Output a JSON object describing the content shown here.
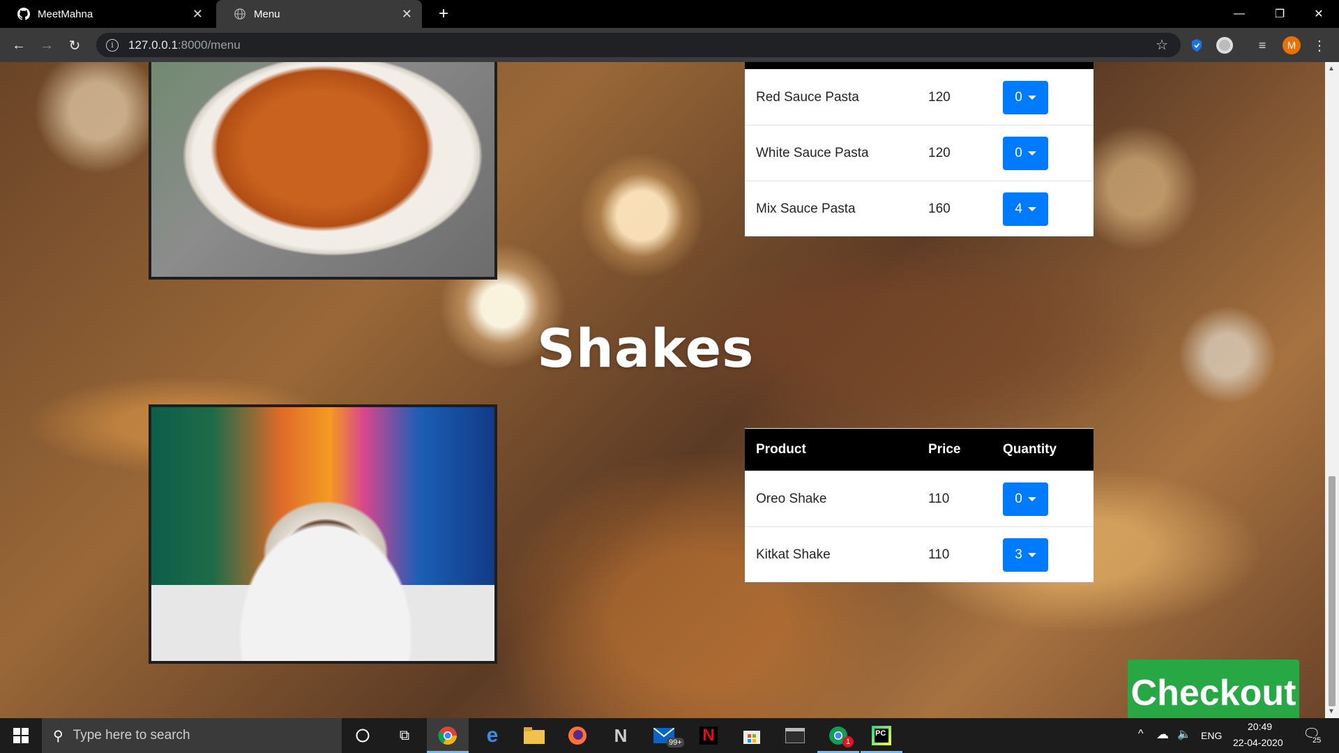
{
  "browser": {
    "tabs": [
      {
        "title": "MeetMahna",
        "active": false
      },
      {
        "title": "Menu",
        "active": true
      }
    ],
    "url_host": "127.0.0.1",
    "url_path": ":8000/menu",
    "profile_initial": "M"
  },
  "pasta": {
    "items": [
      {
        "product": "Red Sauce Pasta",
        "price": "120",
        "qty": "0"
      },
      {
        "product": "White Sauce Pasta",
        "price": "120",
        "qty": "0"
      },
      {
        "product": "Mix Sauce Pasta",
        "price": "160",
        "qty": "4"
      }
    ]
  },
  "shakes": {
    "title": "Shakes",
    "columns": {
      "product": "Product",
      "price": "Price",
      "quantity": "Quantity"
    },
    "items": [
      {
        "product": "Oreo Shake",
        "price": "110",
        "qty": "0"
      },
      {
        "product": "Kitkat Shake",
        "price": "110",
        "qty": "3"
      }
    ]
  },
  "checkout_label": "Checkout",
  "taskbar": {
    "search_placeholder": "Type here to search",
    "mail_badge": "99+",
    "app_badge": "1",
    "language": "ENG",
    "time": "20:49",
    "date": "22-04-2020",
    "notification_count": "25"
  },
  "colors": {
    "primary_button": "#007bff",
    "checkout_button": "#28a745",
    "table_header": "#000000"
  }
}
